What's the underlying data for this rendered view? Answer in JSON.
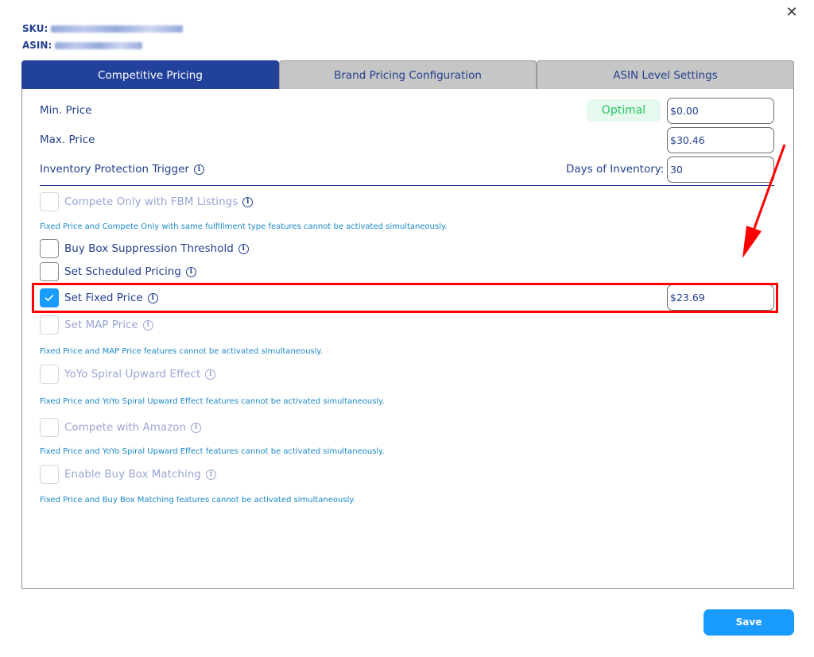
{
  "dialog": {
    "close_glyph": "✕",
    "sku_label": "SKU:",
    "asin_label": "ASIN:"
  },
  "tabs": [
    {
      "label": "Competitive Pricing",
      "active": true
    },
    {
      "label": "Brand Pricing Configuration",
      "active": false
    },
    {
      "label": "ASIN Level Settings",
      "active": false
    }
  ],
  "pricing": {
    "min_price_label": "Min. Price",
    "min_price_status": "Optimal",
    "min_price_value": "$0.00",
    "max_price_label": "Max. Price",
    "max_price_value": "$30.46",
    "inventory_trigger_label": "Inventory Protection Trigger",
    "days_of_inventory_label": "Days of Inventory:",
    "days_of_inventory_value": "30"
  },
  "options": [
    {
      "label": "Compete Only with FBM Listings",
      "checked": false,
      "disabled": true
    },
    {
      "label": "Buy Box Suppression Threshold",
      "checked": false,
      "disabled": false
    },
    {
      "label": "Set Scheduled Pricing",
      "checked": false,
      "disabled": false
    },
    {
      "label": "Set Fixed Price",
      "checked": true,
      "disabled": false,
      "value": "$23.69"
    },
    {
      "label": "Set MAP Price",
      "checked": false,
      "disabled": true
    },
    {
      "label": "YoYo Spiral Upward Effect",
      "checked": false,
      "disabled": true
    },
    {
      "label": "Compete with Amazon",
      "checked": false,
      "disabled": true
    },
    {
      "label": "Enable Buy Box Matching",
      "checked": false,
      "disabled": true
    }
  ],
  "notes": [
    "Fixed Price and Compete Only with same fulfillment type features cannot be activated simultaneously.",
    "Fixed Price and MAP Price features cannot be activated simultaneously.",
    "Fixed Price and YoYo Spiral Upward Effect features cannot be activated simultaneously.",
    "Fixed Price and YoYo Spiral Upward Effect features cannot be activated simultaneously.",
    "Fixed Price and Buy Box Matching features cannot be activated simultaneously."
  ],
  "icons": {
    "info": "i",
    "close": "close-icon",
    "check": "check-icon"
  },
  "colors": {
    "brand_blue": "#22419a",
    "accent_blue": "#1a9bff",
    "note_blue": "#1c89c7",
    "optimal_green": "#22c55e",
    "annotation_red": "#ff0000"
  },
  "footer": {
    "save_label": "Save"
  }
}
